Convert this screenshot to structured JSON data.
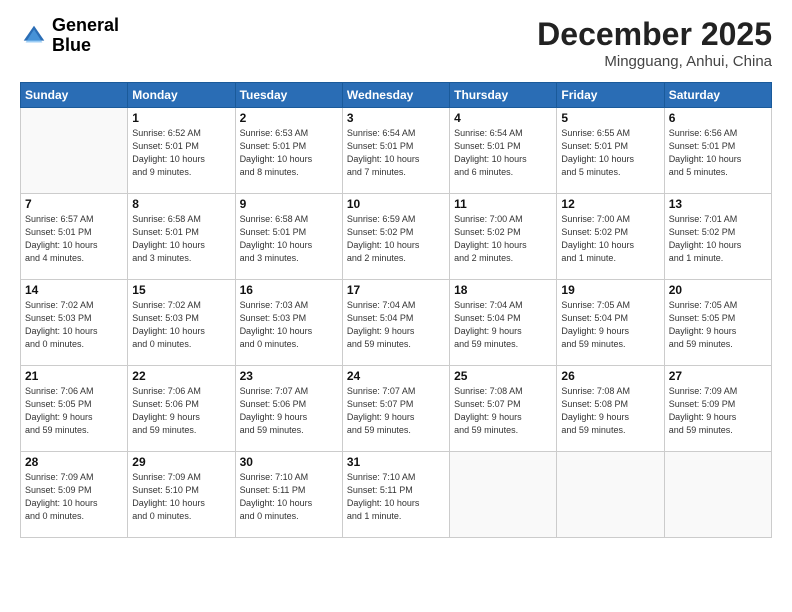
{
  "header": {
    "logo": {
      "general": "General",
      "blue": "Blue"
    },
    "title": "December 2025",
    "location": "Mingguang, Anhui, China"
  },
  "calendar": {
    "weekdays": [
      "Sunday",
      "Monday",
      "Tuesday",
      "Wednesday",
      "Thursday",
      "Friday",
      "Saturday"
    ],
    "weeks": [
      [
        {
          "num": "",
          "info": ""
        },
        {
          "num": "1",
          "info": "Sunrise: 6:52 AM\nSunset: 5:01 PM\nDaylight: 10 hours\nand 9 minutes."
        },
        {
          "num": "2",
          "info": "Sunrise: 6:53 AM\nSunset: 5:01 PM\nDaylight: 10 hours\nand 8 minutes."
        },
        {
          "num": "3",
          "info": "Sunrise: 6:54 AM\nSunset: 5:01 PM\nDaylight: 10 hours\nand 7 minutes."
        },
        {
          "num": "4",
          "info": "Sunrise: 6:54 AM\nSunset: 5:01 PM\nDaylight: 10 hours\nand 6 minutes."
        },
        {
          "num": "5",
          "info": "Sunrise: 6:55 AM\nSunset: 5:01 PM\nDaylight: 10 hours\nand 5 minutes."
        },
        {
          "num": "6",
          "info": "Sunrise: 6:56 AM\nSunset: 5:01 PM\nDaylight: 10 hours\nand 5 minutes."
        }
      ],
      [
        {
          "num": "7",
          "info": "Sunrise: 6:57 AM\nSunset: 5:01 PM\nDaylight: 10 hours\nand 4 minutes."
        },
        {
          "num": "8",
          "info": "Sunrise: 6:58 AM\nSunset: 5:01 PM\nDaylight: 10 hours\nand 3 minutes."
        },
        {
          "num": "9",
          "info": "Sunrise: 6:58 AM\nSunset: 5:01 PM\nDaylight: 10 hours\nand 3 minutes."
        },
        {
          "num": "10",
          "info": "Sunrise: 6:59 AM\nSunset: 5:02 PM\nDaylight: 10 hours\nand 2 minutes."
        },
        {
          "num": "11",
          "info": "Sunrise: 7:00 AM\nSunset: 5:02 PM\nDaylight: 10 hours\nand 2 minutes."
        },
        {
          "num": "12",
          "info": "Sunrise: 7:00 AM\nSunset: 5:02 PM\nDaylight: 10 hours\nand 1 minute."
        },
        {
          "num": "13",
          "info": "Sunrise: 7:01 AM\nSunset: 5:02 PM\nDaylight: 10 hours\nand 1 minute."
        }
      ],
      [
        {
          "num": "14",
          "info": "Sunrise: 7:02 AM\nSunset: 5:03 PM\nDaylight: 10 hours\nand 0 minutes."
        },
        {
          "num": "15",
          "info": "Sunrise: 7:02 AM\nSunset: 5:03 PM\nDaylight: 10 hours\nand 0 minutes."
        },
        {
          "num": "16",
          "info": "Sunrise: 7:03 AM\nSunset: 5:03 PM\nDaylight: 10 hours\nand 0 minutes."
        },
        {
          "num": "17",
          "info": "Sunrise: 7:04 AM\nSunset: 5:04 PM\nDaylight: 9 hours\nand 59 minutes."
        },
        {
          "num": "18",
          "info": "Sunrise: 7:04 AM\nSunset: 5:04 PM\nDaylight: 9 hours\nand 59 minutes."
        },
        {
          "num": "19",
          "info": "Sunrise: 7:05 AM\nSunset: 5:04 PM\nDaylight: 9 hours\nand 59 minutes."
        },
        {
          "num": "20",
          "info": "Sunrise: 7:05 AM\nSunset: 5:05 PM\nDaylight: 9 hours\nand 59 minutes."
        }
      ],
      [
        {
          "num": "21",
          "info": "Sunrise: 7:06 AM\nSunset: 5:05 PM\nDaylight: 9 hours\nand 59 minutes."
        },
        {
          "num": "22",
          "info": "Sunrise: 7:06 AM\nSunset: 5:06 PM\nDaylight: 9 hours\nand 59 minutes."
        },
        {
          "num": "23",
          "info": "Sunrise: 7:07 AM\nSunset: 5:06 PM\nDaylight: 9 hours\nand 59 minutes."
        },
        {
          "num": "24",
          "info": "Sunrise: 7:07 AM\nSunset: 5:07 PM\nDaylight: 9 hours\nand 59 minutes."
        },
        {
          "num": "25",
          "info": "Sunrise: 7:08 AM\nSunset: 5:07 PM\nDaylight: 9 hours\nand 59 minutes."
        },
        {
          "num": "26",
          "info": "Sunrise: 7:08 AM\nSunset: 5:08 PM\nDaylight: 9 hours\nand 59 minutes."
        },
        {
          "num": "27",
          "info": "Sunrise: 7:09 AM\nSunset: 5:09 PM\nDaylight: 9 hours\nand 59 minutes."
        }
      ],
      [
        {
          "num": "28",
          "info": "Sunrise: 7:09 AM\nSunset: 5:09 PM\nDaylight: 10 hours\nand 0 minutes."
        },
        {
          "num": "29",
          "info": "Sunrise: 7:09 AM\nSunset: 5:10 PM\nDaylight: 10 hours\nand 0 minutes."
        },
        {
          "num": "30",
          "info": "Sunrise: 7:10 AM\nSunset: 5:11 PM\nDaylight: 10 hours\nand 0 minutes."
        },
        {
          "num": "31",
          "info": "Sunrise: 7:10 AM\nSunset: 5:11 PM\nDaylight: 10 hours\nand 1 minute."
        },
        {
          "num": "",
          "info": ""
        },
        {
          "num": "",
          "info": ""
        },
        {
          "num": "",
          "info": ""
        }
      ]
    ]
  }
}
